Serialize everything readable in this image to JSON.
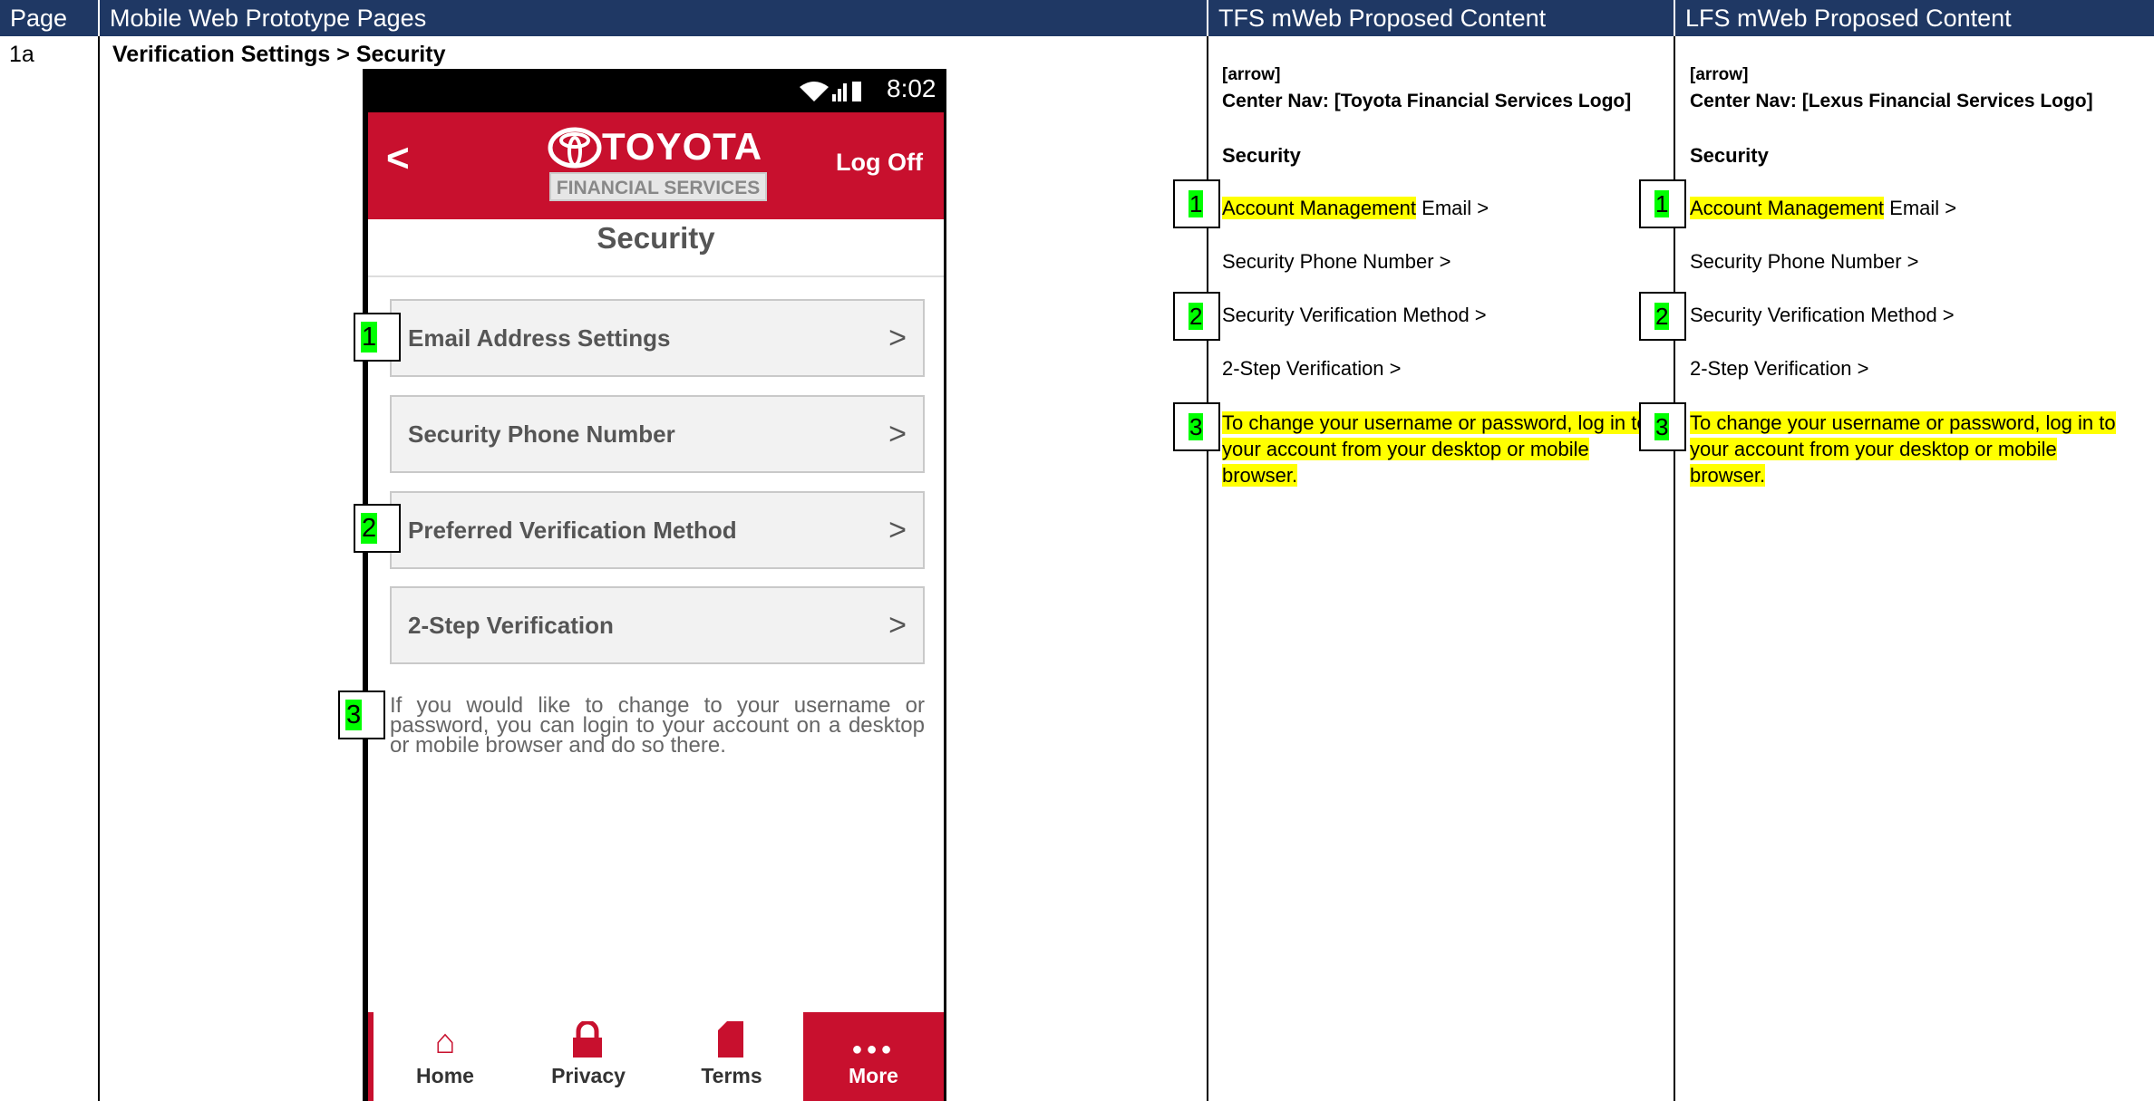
{
  "table": {
    "headers": [
      "Page",
      "Mobile Web Prototype Pages",
      "TFS mWeb Proposed Content",
      "LFS mWeb Proposed Content"
    ],
    "page_id": "1a",
    "page_title": "Verification Settings > Security"
  },
  "phone": {
    "time": "8:02",
    "status_icons": "wifi / signal / battery",
    "back": "<",
    "brand": "TOYOTA",
    "brand_sub": "FINANCIAL SERVICES",
    "log_off": "Log Off",
    "title": "Security",
    "menu": [
      "Email Address Settings",
      "Security Phone Number",
      "Preferred Verification Method",
      "2-Step Verification"
    ],
    "chevron": ">",
    "note": "If you would like to change to your username or password, you can login to your account on a desktop or mobile browser and do so there.",
    "tabs": [
      {
        "label": "Home",
        "icon": "home-icon"
      },
      {
        "label": "Privacy",
        "icon": "lock-icon"
      },
      {
        "label": "Terms",
        "icon": "document-icon"
      },
      {
        "label": "More",
        "icon": "more-dots-icon",
        "glyph": "●●●"
      }
    ],
    "colors": {
      "brand_red": "#c8102e",
      "header_navy": "#1f3864",
      "marker_green": "#00ff00",
      "highlight_yellow": "#ffff00"
    }
  },
  "markers": [
    "1",
    "2",
    "3"
  ],
  "tfs": {
    "arrow": "[arrow]",
    "center_nav": "Center Nav:  [Toyota Financial Services Logo]",
    "title": "Security",
    "item1_hl": "Account Management",
    "item1_rest": " Email  >",
    "item2": "Security Phone Number >",
    "item3": "Security Verification Method >",
    "item4": "2-Step Verification >",
    "note_l1": "To change your username or password, log in to",
    "note_l2": "your account from your desktop or mobile",
    "note_l3": "browser."
  },
  "lfs": {
    "arrow": "[arrow]",
    "center_nav": "Center Nav:  [Lexus Financial Services Logo]",
    "title": "Security",
    "item1_hl": "Account Management",
    "item1_rest": " Email  >",
    "item2": "Security Phone Number >",
    "item3": "Security Verification Method >",
    "item4": "2-Step Verification >",
    "note_l1": "To change your username or password, log in to",
    "note_l2": "your account from your desktop or mobile",
    "note_l3": "browser."
  }
}
